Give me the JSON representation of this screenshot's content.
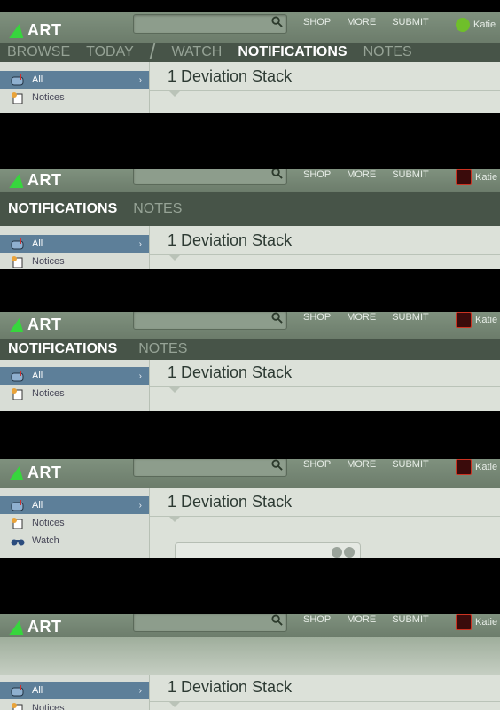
{
  "brand": {
    "logo_text": "ART"
  },
  "toplinks": [
    "SHOP",
    "MORE",
    "SUBMIT"
  ],
  "user": {
    "name": "Katie"
  },
  "nav_tabs": [
    "BROWSE",
    "TODAY",
    "WATCH",
    "NOTIFICATIONS",
    "NOTES"
  ],
  "nav_active": "NOTIFICATIONS",
  "sidebar": {
    "items": [
      {
        "label": "All",
        "icon": "mailbox-icon",
        "selected": true
      },
      {
        "label": "Notices",
        "icon": "notice-icon",
        "selected": false
      },
      {
        "label": "Watch",
        "icon": "binoculars-icon",
        "selected": false
      }
    ]
  },
  "main": {
    "heading": "1 Deviation Stack"
  },
  "colors": {
    "topbar": "#7f917e",
    "navrow": "#475448",
    "selected": "#5d7f99",
    "logo_green": "#37d63d",
    "page_bg": "#dce1d9"
  }
}
